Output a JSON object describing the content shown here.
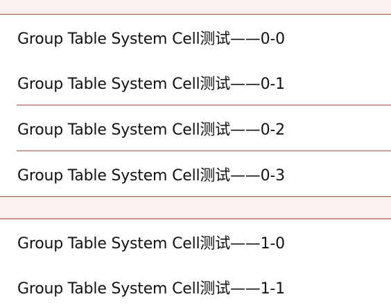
{
  "sections": [
    {
      "cells": [
        {
          "label": "Group Table System Cell测试——0-0"
        },
        {
          "label": "Group Table System Cell测试——0-1"
        },
        {
          "label": "Group Table System Cell测试——0-2"
        },
        {
          "label": "Group Table System Cell测试——0-3"
        }
      ]
    },
    {
      "cells": [
        {
          "label": "Group Table System Cell测试——1-0"
        },
        {
          "label": "Group Table System Cell测试——1-1"
        }
      ]
    }
  ],
  "colors": {
    "separator": "#e53a3a",
    "section_background": "#fbf2f0",
    "cell_background": "#ffffff",
    "text": "#111111"
  }
}
